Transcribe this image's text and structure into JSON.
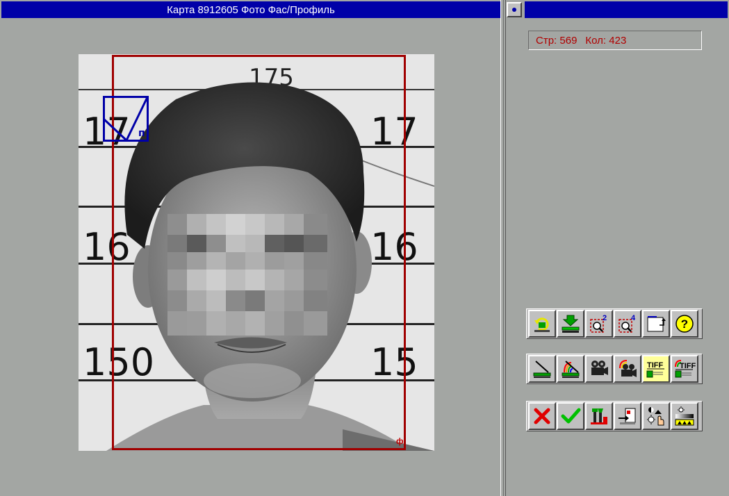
{
  "window": {
    "title": "Карта 8912605 Фото Фас/Профиль"
  },
  "status": {
    "page_label": "Стр: 569",
    "count_label": "Кол: 423"
  },
  "photo": {
    "ruler_marks": [
      "175",
      "17",
      "17",
      "16",
      "16",
      "150",
      "15"
    ],
    "crop_mark": "ф",
    "corner_marker_label": "п",
    "frame_color": "#a00000"
  },
  "toolbars": [
    [
      {
        "name": "rotate-button",
        "icon": "rotate-icon"
      },
      {
        "name": "scan-down-button",
        "icon": "scanner-download-icon"
      },
      {
        "name": "zoom-2x-button",
        "icon": "zoom-2x-icon",
        "label": "2"
      },
      {
        "name": "zoom-4x-button",
        "icon": "zoom-4x-icon",
        "label": "4"
      },
      {
        "name": "crop-frame-button",
        "icon": "frame-corner-icon"
      },
      {
        "name": "help-button",
        "icon": "help-icon",
        "label": "?"
      }
    ],
    [
      {
        "name": "scanner-bw-button",
        "icon": "scanner-icon"
      },
      {
        "name": "scanner-color-button",
        "icon": "scanner-color-icon"
      },
      {
        "name": "camera-bw-button",
        "icon": "video-camera-icon"
      },
      {
        "name": "camera-color-button",
        "icon": "video-camera-color-icon"
      },
      {
        "name": "tiff-button",
        "icon": "tiff-icon",
        "label": "TIFF",
        "active": true
      },
      {
        "name": "tiff-color-button",
        "icon": "tiff-color-icon",
        "label": "TIFF"
      }
    ],
    [
      {
        "name": "cancel-button",
        "icon": "close-icon"
      },
      {
        "name": "accept-button",
        "icon": "checkmark-icon"
      },
      {
        "name": "tools-button",
        "icon": "tools-icon"
      },
      {
        "name": "import-button",
        "icon": "import-icon"
      },
      {
        "name": "brightness-button",
        "icon": "brightness-icon"
      },
      {
        "name": "contrast-button",
        "icon": "contrast-levels-icon"
      }
    ]
  ],
  "colors": {
    "titlebar": "#0000a8",
    "status_text": "#b00000",
    "background": "#a3a6a3"
  }
}
